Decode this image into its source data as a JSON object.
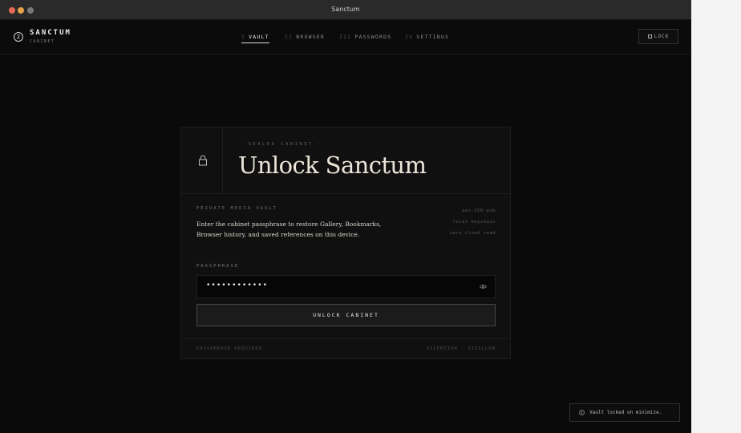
{
  "window": {
    "title": "Sanctum"
  },
  "brand": {
    "mark": "2",
    "name": "SANCTUM",
    "sub": "CABINET"
  },
  "nav": [
    {
      "num": "I",
      "label": "VAULT",
      "active": true
    },
    {
      "num": "II",
      "label": "BROWSER",
      "active": false
    },
    {
      "num": "III",
      "label": "PASSWORDS",
      "active": false
    },
    {
      "num": "IV",
      "label": "SETTINGS",
      "active": false
    }
  ],
  "header": {
    "lock_label": "LOCK"
  },
  "panel": {
    "kicker": "· SEALED CABINET ·",
    "title": "Unlock Sanctum",
    "section_label": "PRIVATE MEDIA VAULT",
    "description": "Enter the cabinet passphrase to restore Gallery, Bookmarks, Browser history, and saved references on this device.",
    "meta": [
      "aes-256-gcm",
      "local keychain",
      "zero cloud read"
    ],
    "field_label": "PASSPHRASE",
    "passphrase_value": "••••••••••••",
    "unlock_label": "UNLOCK CABINET",
    "footer_left": "PASSPHRASE REQUIRED",
    "footer_right": "SILENTIUM · SIGILLUM"
  },
  "toast": {
    "text": "Vault locked on minimize."
  },
  "icons": {
    "lock": "lock-icon",
    "eye": "eye-icon",
    "info": "info-icon"
  },
  "colors": {
    "background": "#0a0a0a",
    "panel": "#101010",
    "accent": "#ece6da"
  }
}
